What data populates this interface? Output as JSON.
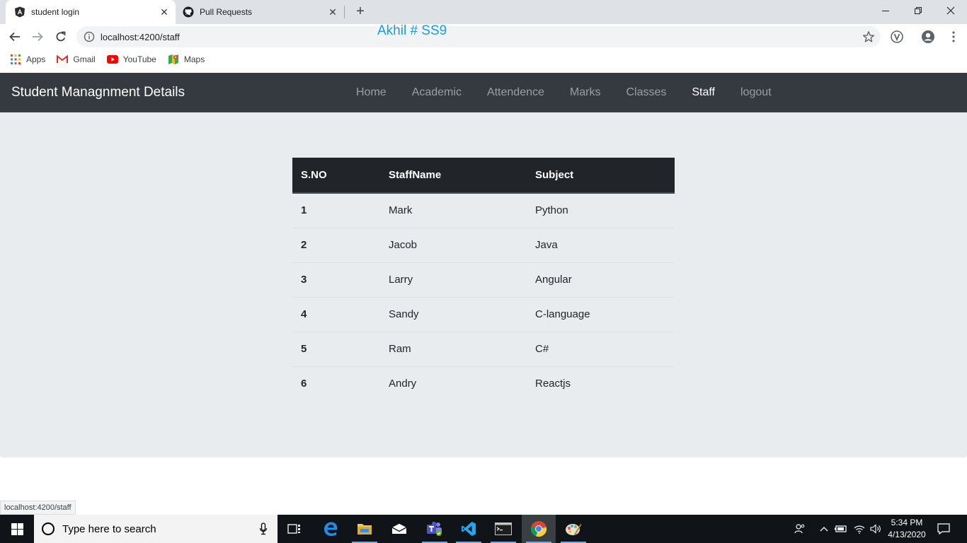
{
  "browser": {
    "tabs": [
      {
        "title": "student login",
        "active": true
      },
      {
        "title": "Pull Requests",
        "active": false
      }
    ],
    "url": "localhost:4200/staff",
    "watermark": "Akhil # SS9",
    "bookmarks": [
      "Apps",
      "Gmail",
      "YouTube",
      "Maps"
    ],
    "status_url": "localhost:4200/staff"
  },
  "app": {
    "brand": "Student Managnment Details",
    "nav": [
      "Home",
      "Academic",
      "Attendence",
      "Marks",
      "Classes",
      "Staff",
      "logout"
    ],
    "active_nav": "Staff",
    "table": {
      "headers": [
        "S.NO",
        "StaffName",
        "Subject"
      ],
      "rows": [
        [
          "1",
          "Mark",
          "Python"
        ],
        [
          "2",
          "Jacob",
          "Java"
        ],
        [
          "3",
          "Larry",
          "Angular"
        ],
        [
          "4",
          "Sandy",
          "C-language"
        ],
        [
          "5",
          "Ram",
          "C#"
        ],
        [
          "6",
          "Andry",
          "Reactjs"
        ]
      ]
    }
  },
  "taskbar": {
    "search_placeholder": "Type here to search",
    "time": "5:34 PM",
    "date": "4/13/2020",
    "apps": [
      "task-view",
      "edge",
      "file-explorer",
      "mail",
      "teams",
      "vscode",
      "terminal",
      "chrome",
      "paint"
    ]
  },
  "colors": {
    "navbar": "#343a40",
    "table_header": "#212529",
    "content_bg": "#e9ecef",
    "watermark": "#1a9fd9"
  }
}
